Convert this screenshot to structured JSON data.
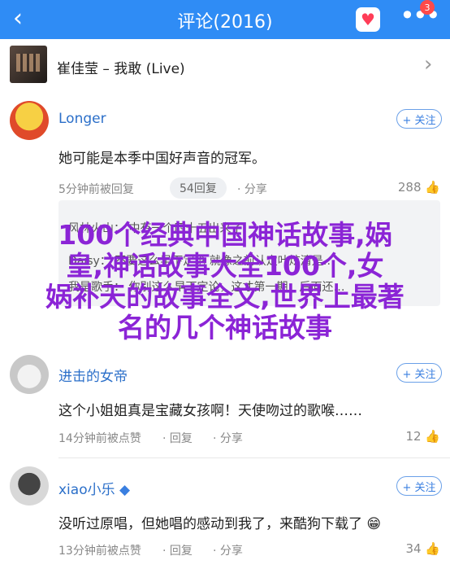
{
  "header": {
    "back": "‹",
    "title": "评论(2016)",
    "heart": "♥",
    "more": "•••",
    "badge": "3"
  },
  "song": {
    "title": "崔佳莹 – 我敢 (Live)",
    "arrow": "›"
  },
  "comments": [
    {
      "user": "Longer",
      "follow": "+ 关注",
      "text": "她可能是本季中国好声音的冠军。",
      "time": "5分钟前被回复",
      "reply_pill": "54回复",
      "share": "分享",
      "likes": "288"
    },
    {
      "user": "进击的女帝",
      "follow": "+ 关注",
      "text": "这个小姐姐真是宝藏女孩啊！天使吻过的歌喉……",
      "time": "14分钟前被点赞",
      "reply": "回复",
      "share": "分享",
      "likes": "12"
    },
    {
      "user": "xiao小乐",
      "follow": "+ 关注",
      "text": "没听过原唱，但她唱的感动到我了，来酷狗下载了",
      "time": "13分钟前被点赞",
      "reply": "回复",
      "share": "分享",
      "likes": "34"
    }
  ],
  "reply_box": {
    "line1": "风林火山：  中有一个四十五出来了",
    "line2": "Daisy：  不要这么早下定论 就像之前认定叶炫清是…",
    "line3": "我是歌手：  你别这么早下定论，这才第一期，后面还…"
  },
  "overlay": {
    "line1": "100个经典中国神话故事,娲",
    "line2": "皇,神话故事大全100个,女",
    "line3": "娲补天的故事全文,世界上最著",
    "line4": "名的几个神话故事"
  }
}
